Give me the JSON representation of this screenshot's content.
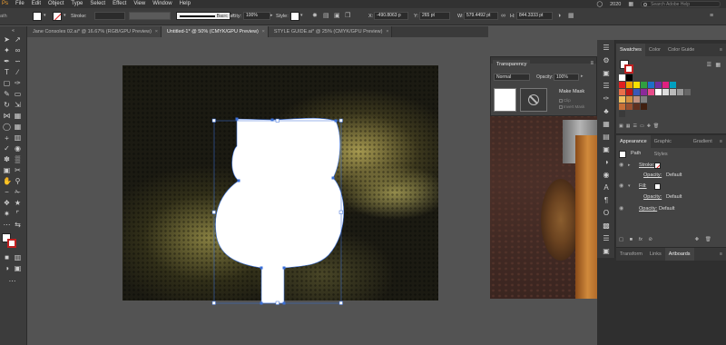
{
  "menu": [
    "File",
    "Edit",
    "Object",
    "Type",
    "Select",
    "Effect",
    "View",
    "Window",
    "Help"
  ],
  "menu_left_fragment": "Ps",
  "menu_right": {
    "year": "2020",
    "search_placeholder": "Search Adobe Help"
  },
  "control": {
    "stroke_label": "Stroke:",
    "stroke_profile": "Basic",
    "opacity_label": "Opacity:",
    "opacity_value": "100%",
    "style_label": "Style:",
    "x_label": "X:",
    "x_value": "-490.8063 p",
    "y_label": "Y:",
    "y_value": "265 pt",
    "w_label": "W:",
    "w_value": "579.4492 pt",
    "h_label": "H:",
    "h_value": "844.3333 pt"
  },
  "tabs": [
    {
      "label": "Jane Consoles 02.ai* @ 16.67% (RGB/GPU Preview)",
      "active": false
    },
    {
      "label": "Untitled-1* @ 50% (CMYK/GPU Preview)",
      "active": true
    },
    {
      "label": "STYLE GUIDE.ai* @ 25% (CMYK/GPU Preview)",
      "active": false
    }
  ],
  "transparency": {
    "title": "Transparency",
    "blend_mode": "Normal",
    "opacity_label": "Opacity:",
    "opacity_value": "100%",
    "make_mask": "Make Mask",
    "clip": "Clip",
    "invert_mask": "Invert Mask"
  },
  "swatches_panel": {
    "tabs": [
      "Swatches",
      "Color",
      "Color Guide"
    ],
    "active": "Swatches"
  },
  "appearance_panel": {
    "tabs": [
      "Appearance",
      "Graphic Styles",
      "Gradient"
    ],
    "active": "Appearance",
    "object": "Path",
    "rows": [
      {
        "type": "stroke",
        "name": "Stroke:",
        "value": ""
      },
      {
        "type": "opacity",
        "name": "Opacity:",
        "value": "Default"
      },
      {
        "type": "fill",
        "name": "Fill:",
        "value": ""
      },
      {
        "type": "opacity",
        "name": "Opacity:",
        "value": "Default"
      },
      {
        "type": "opacity",
        "name": "Opacity:",
        "value": "Default"
      }
    ]
  },
  "bottom_panel": {
    "tabs": [
      "Transform",
      "Links",
      "Artboards"
    ],
    "active": "Artboards"
  },
  "colors": {
    "fill": "#ffffff",
    "selection": "#3a6fd8"
  }
}
